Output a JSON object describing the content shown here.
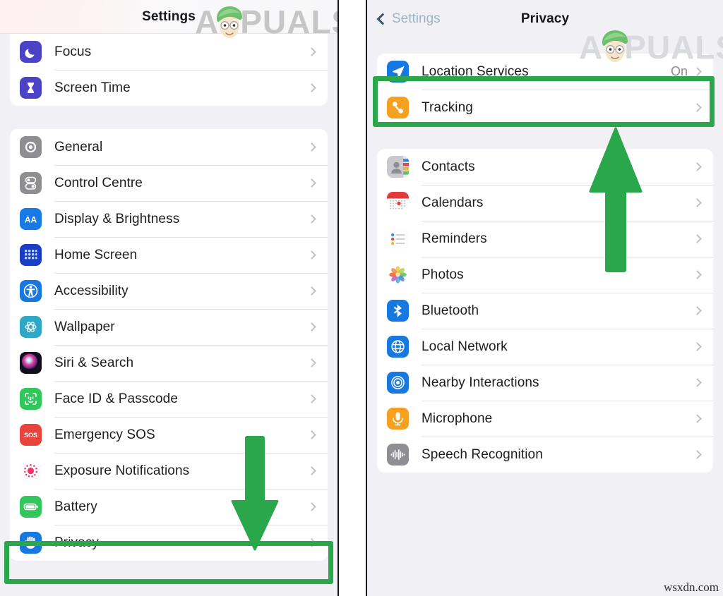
{
  "left_phone": {
    "nav": {
      "title": "Settings"
    },
    "groups": [
      {
        "id": "group-a",
        "rows": [
          {
            "label": "Focus",
            "icon": "focus-icon",
            "value": ""
          },
          {
            "label": "Screen Time",
            "icon": "screen-time-icon",
            "value": ""
          }
        ]
      },
      {
        "id": "group-b",
        "rows": [
          {
            "label": "General",
            "icon": "general-gear-icon",
            "value": ""
          },
          {
            "label": "Control Centre",
            "icon": "control-centre-icon",
            "value": ""
          },
          {
            "label": "Display & Brightness",
            "icon": "display-brightness-icon",
            "value": ""
          },
          {
            "label": "Home Screen",
            "icon": "home-screen-icon",
            "value": ""
          },
          {
            "label": "Accessibility",
            "icon": "accessibility-icon",
            "value": ""
          },
          {
            "label": "Wallpaper",
            "icon": "wallpaper-icon",
            "value": ""
          },
          {
            "label": "Siri & Search",
            "icon": "siri-search-icon",
            "value": ""
          },
          {
            "label": "Face ID & Passcode",
            "icon": "face-id-icon",
            "value": ""
          },
          {
            "label": "Emergency SOS",
            "icon": "emergency-sos-icon",
            "value": ""
          },
          {
            "label": "Exposure Notifications",
            "icon": "exposure-notifications-icon",
            "value": ""
          },
          {
            "label": "Battery",
            "icon": "battery-icon",
            "value": ""
          },
          {
            "label": "Privacy",
            "icon": "privacy-hand-icon",
            "value": ""
          }
        ]
      }
    ]
  },
  "right_phone": {
    "nav": {
      "back_label": "Settings",
      "title": "Privacy"
    },
    "groups": [
      {
        "id": "group-a",
        "rows": [
          {
            "label": "Location Services",
            "icon": "location-services-icon",
            "value": "On"
          },
          {
            "label": "Tracking",
            "icon": "tracking-icon",
            "value": ""
          }
        ]
      },
      {
        "id": "group-b",
        "rows": [
          {
            "label": "Contacts",
            "icon": "contacts-icon",
            "value": ""
          },
          {
            "label": "Calendars",
            "icon": "calendars-icon",
            "value": ""
          },
          {
            "label": "Reminders",
            "icon": "reminders-icon",
            "value": ""
          },
          {
            "label": "Photos",
            "icon": "photos-icon",
            "value": ""
          },
          {
            "label": "Bluetooth",
            "icon": "bluetooth-icon",
            "value": ""
          },
          {
            "label": "Local Network",
            "icon": "local-network-icon",
            "value": ""
          },
          {
            "label": "Nearby Interactions",
            "icon": "nearby-interactions-icon",
            "value": ""
          },
          {
            "label": "Microphone",
            "icon": "microphone-icon",
            "value": ""
          },
          {
            "label": "Speech Recognition",
            "icon": "speech-recognition-icon",
            "value": ""
          }
        ]
      }
    ]
  },
  "annotations": {
    "highlight_color": "#2aa64b",
    "left_highlight_target": "Privacy",
    "right_highlight_target": "Location Services",
    "left_arrow_direction": "down",
    "right_arrow_direction": "up"
  },
  "watermarks": {
    "brand": "APPUALS",
    "brand_left": "PUALS",
    "brand_a": "A",
    "site": "wsxdn.com"
  }
}
